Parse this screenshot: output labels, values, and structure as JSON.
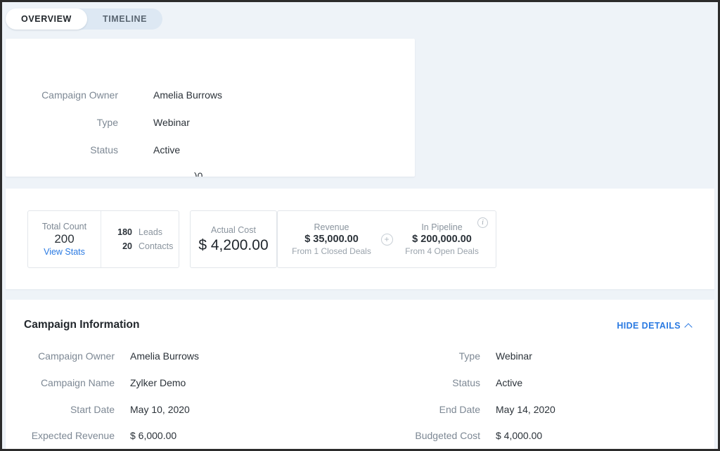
{
  "tabs": [
    {
      "label": "OVERVIEW",
      "active": true
    },
    {
      "label": "TIMELINE",
      "active": false
    }
  ],
  "summary_card": {
    "rows": [
      {
        "label": "Campaign Owner",
        "value": "Amelia Burrows"
      },
      {
        "label": "Type",
        "value": "Webinar"
      },
      {
        "label": "Status",
        "value": "Active"
      }
    ],
    "clipped_fragment": ")0"
  },
  "stats": {
    "total_count": {
      "caption": "Total Count",
      "value": "200",
      "link_label": "View Stats",
      "breakdown": [
        {
          "number": "180",
          "label": "Leads"
        },
        {
          "number": "20",
          "label": "Contacts"
        }
      ]
    },
    "actual_cost": {
      "caption": "Actual Cost",
      "amount": "$ 4,200.00"
    },
    "revenue": {
      "caption": "Revenue",
      "amount": "$ 35,000.00",
      "sub": "From 1 Closed Deals"
    },
    "in_pipeline": {
      "caption": "In Pipeline",
      "amount": "$ 200,000.00",
      "sub": "From 4 Open Deals"
    },
    "plus_icon": "plus-circle-icon",
    "info_icon": "info-circle-icon"
  },
  "campaign_information": {
    "title": "Campaign Information",
    "hide_details_label": "HIDE DETAILS",
    "left_rows": [
      {
        "label": "Campaign Owner",
        "value": "Amelia Burrows"
      },
      {
        "label": "Campaign Name",
        "value": "Zylker Demo"
      },
      {
        "label": "Start Date",
        "value": "May 10, 2020"
      },
      {
        "label": "Expected Revenue",
        "value": "$ 6,000.00"
      }
    ],
    "right_rows": [
      {
        "label": "Type",
        "value": "Webinar"
      },
      {
        "label": "Status",
        "value": "Active"
      },
      {
        "label": "End Date",
        "value": "May 14, 2020"
      },
      {
        "label": "Budgeted Cost",
        "value": "$ 4,000.00"
      }
    ]
  },
  "colors": {
    "background": "#eef3f8",
    "card": "#ffffff",
    "link": "#2a7ae2",
    "tab_track": "#dde8f3",
    "label": "#7d8894",
    "value": "#2b3239"
  }
}
